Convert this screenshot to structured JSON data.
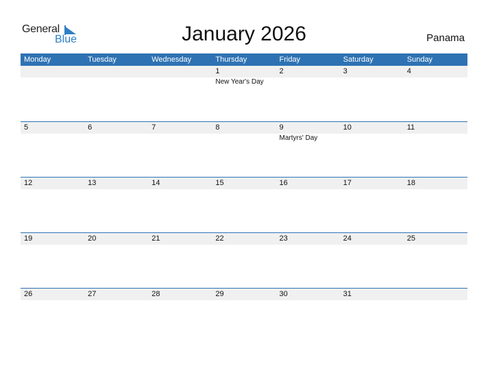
{
  "logo": {
    "word1": "General",
    "word2": "Blue"
  },
  "title": "January 2026",
  "country": "Panama",
  "weekdays": [
    "Monday",
    "Tuesday",
    "Wednesday",
    "Thursday",
    "Friday",
    "Saturday",
    "Sunday"
  ],
  "weeks": [
    {
      "days": [
        "",
        "",
        "",
        "1",
        "2",
        "3",
        "4"
      ],
      "events": [
        "",
        "",
        "",
        "New Year's Day",
        "",
        "",
        ""
      ]
    },
    {
      "days": [
        "5",
        "6",
        "7",
        "8",
        "9",
        "10",
        "11"
      ],
      "events": [
        "",
        "",
        "",
        "",
        "Martyrs' Day",
        "",
        ""
      ]
    },
    {
      "days": [
        "12",
        "13",
        "14",
        "15",
        "16",
        "17",
        "18"
      ],
      "events": [
        "",
        "",
        "",
        "",
        "",
        "",
        ""
      ]
    },
    {
      "days": [
        "19",
        "20",
        "21",
        "22",
        "23",
        "24",
        "25"
      ],
      "events": [
        "",
        "",
        "",
        "",
        "",
        "",
        ""
      ]
    },
    {
      "days": [
        "26",
        "27",
        "28",
        "29",
        "30",
        "31",
        ""
      ],
      "events": [
        "",
        "",
        "",
        "",
        "",
        "",
        ""
      ]
    }
  ]
}
